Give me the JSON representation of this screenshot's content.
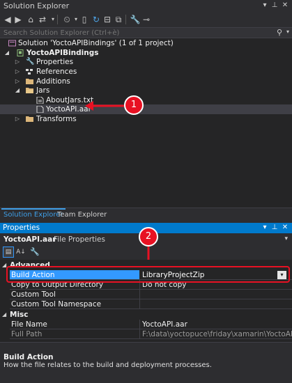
{
  "solution_explorer": {
    "title": "Solution Explorer",
    "search_placeholder": "Search Solution Explorer (Ctrl+è)",
    "tree": [
      {
        "label": "Solution 'YoctoAPIBindings' (1 of 1 project)"
      },
      {
        "label": "YoctoAPIBindings"
      },
      {
        "label": "Properties"
      },
      {
        "label": "References"
      },
      {
        "label": "Additions"
      },
      {
        "label": "Jars"
      },
      {
        "label": "AboutJars.txt"
      },
      {
        "label": "YoctoAPI.aar"
      },
      {
        "label": "Transforms"
      }
    ],
    "tabs": [
      "Solution Explorer",
      "Team Explorer"
    ]
  },
  "properties": {
    "title": "Properties",
    "object_name": "YoctoAPI.aar",
    "object_type": "File Properties",
    "categories": {
      "advanced": "Advanced",
      "misc": "Misc"
    },
    "rows": [
      {
        "name": "Build Action",
        "value": "LibraryProjectZip"
      },
      {
        "name": "Copy to Output Directory",
        "value": "Do not copy"
      },
      {
        "name": "Custom Tool",
        "value": ""
      },
      {
        "name": "Custom Tool Namespace",
        "value": ""
      },
      {
        "name": "File Name",
        "value": "YoctoAPI.aar"
      },
      {
        "name": "Full Path",
        "value": "F:\\data\\yoctopuce\\friday\\xamarin\\YoctoAPIBindings"
      }
    ],
    "description_title": "Build Action",
    "description_text": "How the file relates to the build and deployment processes."
  },
  "annotations": {
    "callout_1": "1",
    "callout_2": "2",
    "annotation_color": "#e81123"
  },
  "colors": {
    "accent": "#007acc",
    "selection": "#3f3f46",
    "background": "#252526"
  }
}
